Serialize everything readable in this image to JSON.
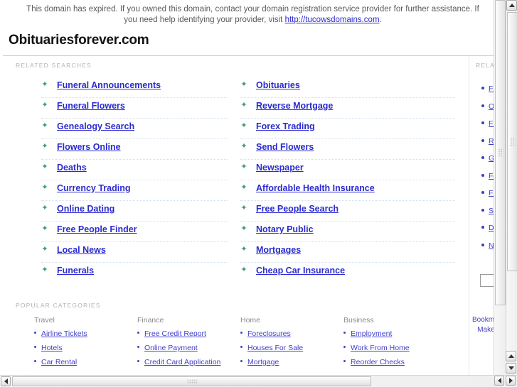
{
  "notice": {
    "text_before": "This domain has expired. If you owned this domain, contact your domain registration service provider for further assistance. If you need help identifying your provider, visit ",
    "link_text": "http://tucowsdomains.com",
    "text_after": "."
  },
  "header": {
    "domain_title": "Obituariesforever.com"
  },
  "main": {
    "related_searches_label": "RELATED SEARCHES",
    "popular_categories_label": "POPULAR CATEGORIES",
    "related_searches": {
      "column_1": [
        "Funeral Announcements",
        "Funeral Flowers",
        "Genealogy Search",
        "Flowers Online",
        "Deaths",
        "Currency Trading",
        "Online Dating",
        "Free People Finder",
        "Local News",
        "Funerals"
      ],
      "column_2": [
        "Obituaries",
        "Reverse Mortgage",
        "Forex Trading",
        "Send Flowers",
        "Newspaper",
        "Affordable Health Insurance",
        "Free People Search",
        "Notary Public",
        "Mortgages",
        "Cheap Car Insurance"
      ]
    },
    "categories": [
      {
        "heading": "Travel",
        "links": [
          "Airline Tickets",
          "Hotels",
          "Car Rental"
        ]
      },
      {
        "heading": "Finance",
        "links": [
          "Free Credit Report",
          "Online Payment",
          "Credit Card Application"
        ]
      },
      {
        "heading": "Home",
        "links": [
          "Foreclosures",
          "Houses For Sale",
          "Mortgage"
        ]
      },
      {
        "heading": "Business",
        "links": [
          "Employment",
          "Work From Home",
          "Reorder Checks"
        ]
      }
    ]
  },
  "rail": {
    "label": "RELATED",
    "links": [
      "Fu",
      "Ob",
      "Fu",
      "Re",
      "Ge",
      "Fo",
      "Fl",
      "Se",
      "De",
      "Ne"
    ],
    "footer": [
      "Bookmark",
      "Make thi"
    ]
  },
  "colors": {
    "link": "#2b2bd0",
    "star_bullet": "#3f9e6e",
    "separator": "#cfe0f0",
    "section_label": "#b3b3b3",
    "title": "#111111",
    "notice_text": "#5a5a5a",
    "rule": "#b9cfe6"
  }
}
